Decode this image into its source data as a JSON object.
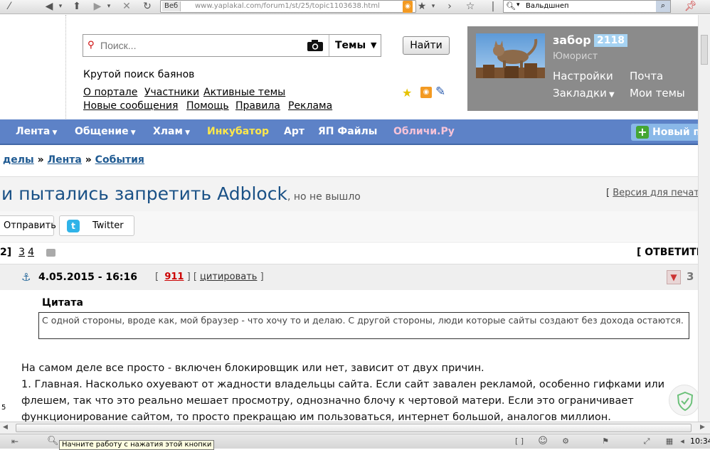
{
  "browser": {
    "web_badge": "Веб",
    "url": "www.yaplakal.com/forum1/st/25/topic1103638.html",
    "search_text": "Вальдшнеп",
    "tooltip": "Начните работу с нажатия этой кнопки",
    "clock": "10:34"
  },
  "header": {
    "search_placeholder": "Поиск...",
    "themes_select": "Темы",
    "find_button": "Найти",
    "tagline": "Крутой поиск баянов",
    "links": [
      "О портале",
      "Участники",
      "Активные темы",
      "Новые сообщения",
      "Помощь",
      "Правила",
      "Реклама"
    ]
  },
  "user": {
    "name": "забор",
    "count": "2118",
    "rank": "Юморист",
    "settings": "Настройки",
    "mail": "Почта",
    "bookmarks": "Закладки",
    "my_topics": "Мои темы"
  },
  "nav": {
    "items": [
      "Лента",
      "Общение",
      "Хлам",
      "Инкубатор",
      "Арт",
      "ЯП Файлы",
      "Обличи.Ру"
    ],
    "new_post": "Новый по"
  },
  "breadcrumb": {
    "part1": "делы",
    "part2": "Лента",
    "part3": "События",
    "sep": "»"
  },
  "topic": {
    "title": "и пытались запретить Adblock",
    "subtitle": ", но не вышло",
    "print_prefix": "[",
    "print_link": "Версия для печати"
  },
  "share": {
    "send": "Отправить",
    "twitter": "Twitter"
  },
  "pages": {
    "current": "2]",
    "p3": "3",
    "p4": "4",
    "reply": "[ ОТВЕТИТЬ"
  },
  "post": {
    "date": "4.05.2015 - 16:16",
    "bracket_open": "[",
    "number": "911",
    "bracket_mid": "] [",
    "cite": "цитировать",
    "bracket_close": "]",
    "rating": "3",
    "quote_label": "Цитата",
    "quote_text": "С одной стороны, вроде как, мой браузер - что хочу то и делаю. С другой стороны, люди которые сайты создают без дохода остаются.",
    "body": [
      "На самом деле все просто - включен блокировщик или нет, зависит от двух причин.",
      "1. Главная. Насколько охуевают от жадности владельцы сайта. Если сайт завален рекламой, особенно гифками или",
      "флешем, так что это реально мешает просмотру, однозначно блочу к чертовой матери. Если это ограничивает",
      "функционирование сайтом, то просто прекращаю им пользоваться, интернет большой, аналогов миллион."
    ]
  },
  "colors": {
    "nav_bg": "#5d82c7",
    "incubator": "#ffe84a",
    "oblichi": "#f6c3d8",
    "link_blue": "#1f5a92",
    "user_panel": "#8b8b8b"
  }
}
